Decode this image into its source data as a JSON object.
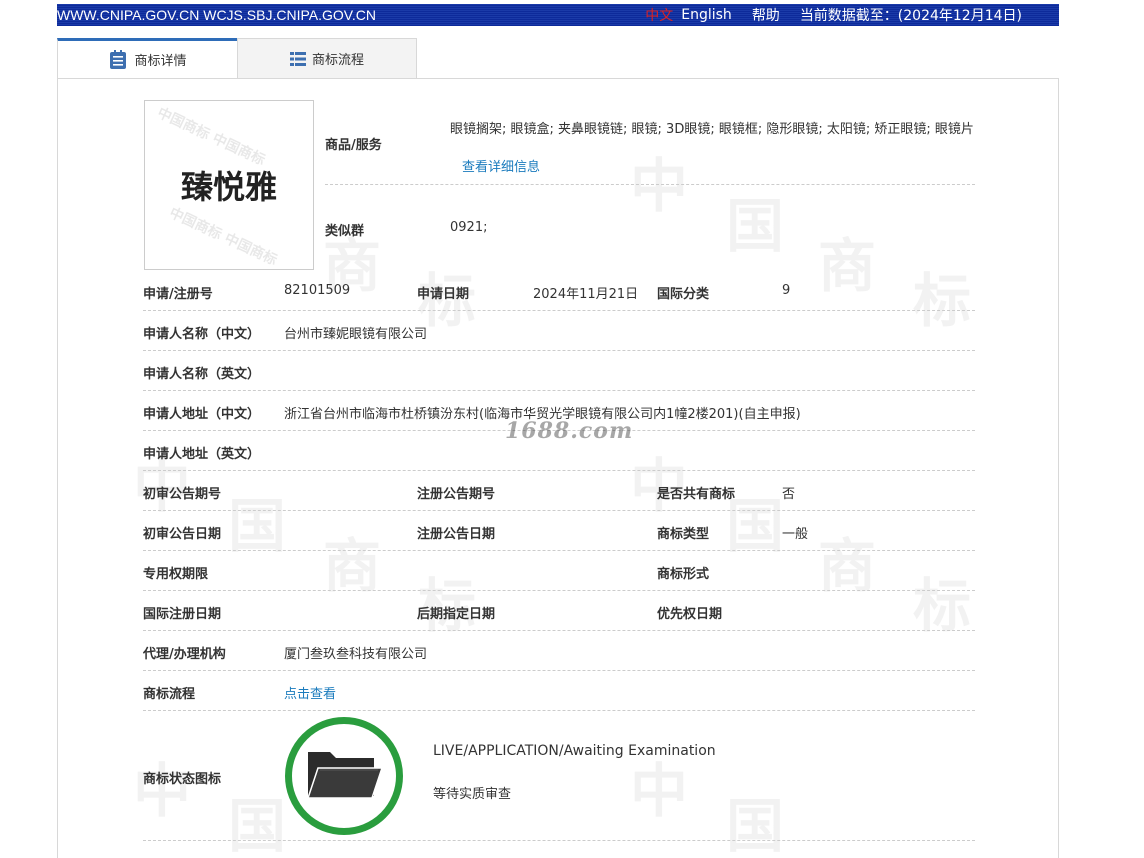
{
  "topbar": {
    "site": "WWW.CNIPA.GOV.CN WCJS.SBJ.CNIPA.GOV.CN",
    "lang_cn": "中文",
    "lang_en": "English",
    "help": "帮助",
    "data_as_of": "当前数据截至：(2024年12月14日)"
  },
  "tabs": [
    {
      "label": "商标详情"
    },
    {
      "label": "商标流程"
    }
  ],
  "logo": {
    "text": "臻悦雅"
  },
  "goods": {
    "label": "商品/服务",
    "value": "眼镜搁架; 眼镜盒; 夹鼻眼镜链; 眼镜; 3D眼镜; 眼镜框; 隐形眼镜; 太阳镜; 矫正眼镜; 眼镜片",
    "more_link": "查看详细信息"
  },
  "similar_group": {
    "label": "类似群",
    "value": "0921;"
  },
  "fields": {
    "reg_no_label": "申请/注册号",
    "reg_no": "82101509",
    "app_date_label": "申请日期",
    "app_date": "2024年11月21日",
    "intl_class_label": "国际分类",
    "intl_class": "9",
    "applicant_cn_label": "申请人名称（中文）",
    "applicant_cn": "台州市臻妮眼镜有限公司",
    "applicant_en_label": "申请人名称（英文）",
    "applicant_en": "",
    "address_cn_label": "申请人地址（中文）",
    "address_cn": "浙江省台州市临海市杜桥镇汾东村(临海市华贸光学眼镜有限公司内1幢2楼201)(自主申报)",
    "address_en_label": "申请人地址（英文）",
    "address_en": "",
    "prelim_pub_no_label": "初审公告期号",
    "prelim_pub_no": "",
    "reg_pub_no_label": "注册公告期号",
    "reg_pub_no": "",
    "shared_label": "是否共有商标",
    "shared": "否",
    "prelim_pub_date_label": "初审公告日期",
    "prelim_pub_date": "",
    "reg_pub_date_label": "注册公告日期",
    "reg_pub_date": "",
    "tm_type_label": "商标类型",
    "tm_type": "一般",
    "exclusive_period_label": "专用权期限",
    "exclusive_period": "",
    "tm_form_label": "商标形式",
    "tm_form": "",
    "intl_reg_date_label": "国际注册日期",
    "intl_reg_date": "",
    "later_designation_label": "后期指定日期",
    "later_designation": "",
    "priority_date_label": "优先权日期",
    "priority_date": "",
    "agent_label": "代理/办理机构",
    "agent": "厦门叁玖叁科技有限公司",
    "process_label": "商标流程",
    "process_link": "点击查看"
  },
  "status": {
    "label": "商标状态图标",
    "en": "LIVE/APPLICATION/Awaiting Examination",
    "cn": "等待实质审查"
  },
  "site_mark": "1688.com",
  "colors": {
    "banner": "#0d2a9a",
    "link": "#1a7bbd",
    "status_ring": "#2a9d3e",
    "tab_accent": "#2e6cb8"
  }
}
